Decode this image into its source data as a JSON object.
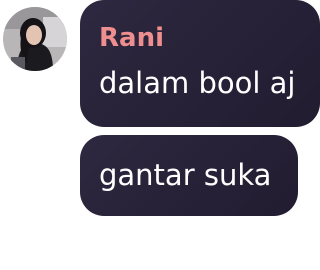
{
  "messages": [
    {
      "sender": "Rani",
      "text": "dalam bool aj"
    },
    {
      "text": "gantar suka"
    }
  ],
  "avatar": {
    "icon": "user-avatar-photo"
  },
  "colors": {
    "bubble_bg": "#2a2438",
    "sender_name": "#ef8e8e",
    "message_text": "#ffffff"
  }
}
